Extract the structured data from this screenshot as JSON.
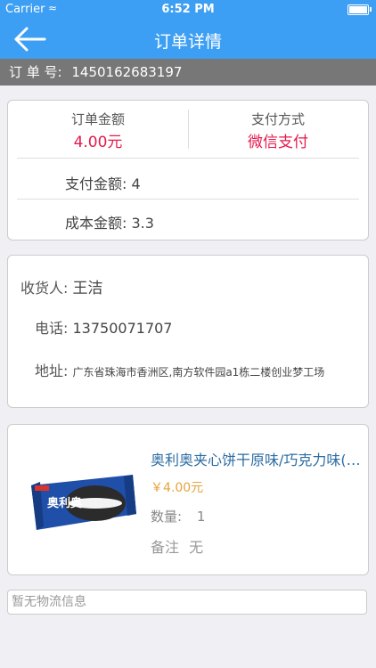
{
  "status_bar": {
    "carrier": "Carrier",
    "time": "6:52 PM"
  },
  "nav": {
    "title": "订单详情"
  },
  "order": {
    "number_label": "订 单 号:",
    "number": "1450162683197"
  },
  "summary": {
    "amount_label": "订单金额",
    "amount_value": "4.00元",
    "pay_method_label": "支付方式",
    "pay_method_value": "微信支付",
    "paid_label": "支付金额:",
    "paid_value": "4",
    "cost_label": "成本金额:",
    "cost_value": "3.3"
  },
  "address": {
    "recipient_label": "收货人:",
    "recipient": "王洁",
    "phone_label": "电话:",
    "phone": "13750071707",
    "address_label": "地址:",
    "address": "广东省珠海市香洲区,南方软件园a1栋二楼创业梦工场"
  },
  "product": {
    "name": "奥利奥夹心饼干原味/巧克力味(盒装)",
    "price": "￥4.00元",
    "qty_label": "数量:",
    "qty": "1",
    "note_label": "备注",
    "note": "无",
    "image_text": "奥利奥"
  },
  "logistics": {
    "text": "暂无物流信息"
  },
  "colors": {
    "nav_blue": "#3d9ff3",
    "accent_red": "#e6194b",
    "price_orange": "#e8a23c"
  }
}
